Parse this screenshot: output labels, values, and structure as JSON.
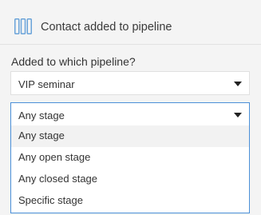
{
  "header": {
    "icon": "pipeline-columns-icon",
    "title": "Contact added to pipeline"
  },
  "form": {
    "pipeline_label": "Added to which pipeline?",
    "pipeline_select": {
      "value": "VIP seminar",
      "icon": "chevron-down-icon"
    },
    "stage_select": {
      "value": "Any stage",
      "icon": "chevron-down-icon",
      "expanded": true,
      "options": [
        "Any stage",
        "Any open stage",
        "Any closed stage",
        "Specific stage"
      ],
      "highlighted_option": "Any stage"
    }
  },
  "colors": {
    "accent": "#4a8fd8",
    "icon": "#6aa3d9",
    "background": "#f4f4f4",
    "text": "#333333"
  }
}
